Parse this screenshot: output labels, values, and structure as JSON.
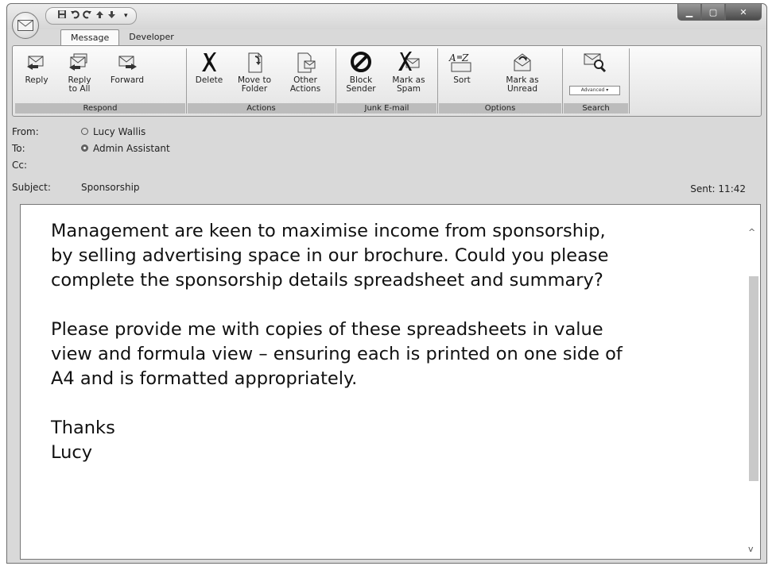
{
  "quick_access": {
    "save_icon": "save-icon",
    "undo_icon": "undo-icon",
    "redo_icon": "redo-icon",
    "up_icon": "previous-item-icon",
    "down_icon": "next-item-icon",
    "dropdown": "▾"
  },
  "window_controls": {
    "minimize": "▁",
    "maximize": "▢",
    "close": "✕"
  },
  "tabs": [
    {
      "label": "Message",
      "active": true
    },
    {
      "label": "Developer",
      "active": false
    }
  ],
  "ribbon": {
    "groups": [
      {
        "label": "Respond",
        "buttons": [
          "Reply",
          "Reply\nto All",
          "Forward"
        ]
      },
      {
        "label": "Actions",
        "buttons": [
          "Delete",
          "Move to\nFolder",
          "Other\nActions"
        ]
      },
      {
        "label": "Junk E-mail",
        "buttons": [
          "Block\nSender",
          "Mark as\nSpam"
        ]
      },
      {
        "label": "Options",
        "buttons": [
          "Sort",
          "Mark as\nUnread"
        ]
      },
      {
        "label": "Search",
        "dropdown_label": "Advanced",
        "dropdown_arrow": "▾"
      }
    ]
  },
  "message_header": {
    "from_label": "From:",
    "from_value": "Lucy Wallis",
    "to_label": "To:",
    "to_value": "Admin Assistant",
    "cc_label": "Cc:",
    "cc_value": "",
    "subject_label": "Subject:",
    "subject_value": "Sponsorship",
    "sent": "Sent: 11:42"
  },
  "message_body": {
    "paragraphs": [
      "Management are keen to maximise income from sponsorship,\nby selling advertising space in our brochure. Could you please\ncomplete the sponsorship details spreadsheet and summary?",
      "Please provide me with copies of these spreadsheets in value\nview and formula view – ensuring each is printed on one side of\nA4 and is formatted appropriately.",
      "Thanks\nLucy"
    ]
  },
  "scrollbar": {
    "up": "^",
    "down": "v",
    "position": 0
  }
}
